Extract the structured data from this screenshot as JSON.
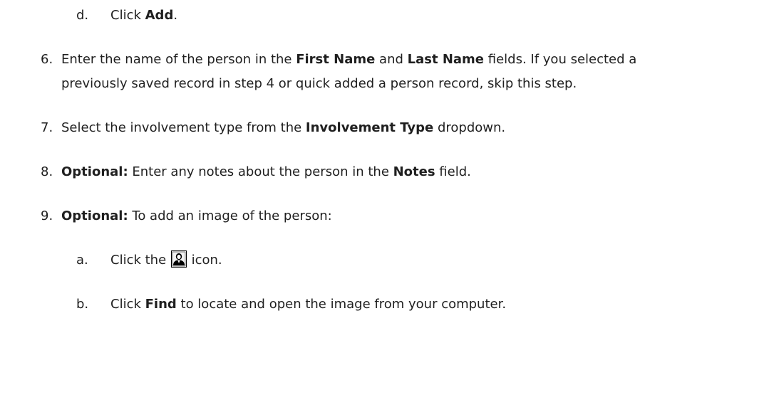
{
  "steps": {
    "d": {
      "marker": "d.",
      "text_pre": "Click ",
      "bold": "Add",
      "text_post": "."
    },
    "s6": {
      "marker": "6.",
      "text_pre": "Enter the name of the person in the ",
      "bold1": "First Name",
      "text_mid": " and ",
      "bold2": "Last Name",
      "text_post": " fields. If you selected a",
      "line2": "previously saved record in step 4 or quick added a person record, skip this step."
    },
    "s7": {
      "marker": "7.",
      "text_pre": "Select the involvement type from the ",
      "bold": "Involvement Type",
      "text_post": " dropdown."
    },
    "s8": {
      "marker": "8.",
      "bold_lead": "Optional:",
      "text_pre": " Enter any notes about the person in the ",
      "bold": "Notes",
      "text_post": " field."
    },
    "s9": {
      "marker": "9.",
      "bold_lead": "Optional:",
      "text_post": " To add an image of the person:"
    },
    "s9a": {
      "marker": "a.",
      "text_pre": "Click the ",
      "icon": "person-silhouette-icon",
      "text_post": " icon."
    },
    "s9b": {
      "marker": "b.",
      "text_pre": "Click ",
      "bold": "Find",
      "text_post": " to locate and open the image from your computer."
    }
  }
}
